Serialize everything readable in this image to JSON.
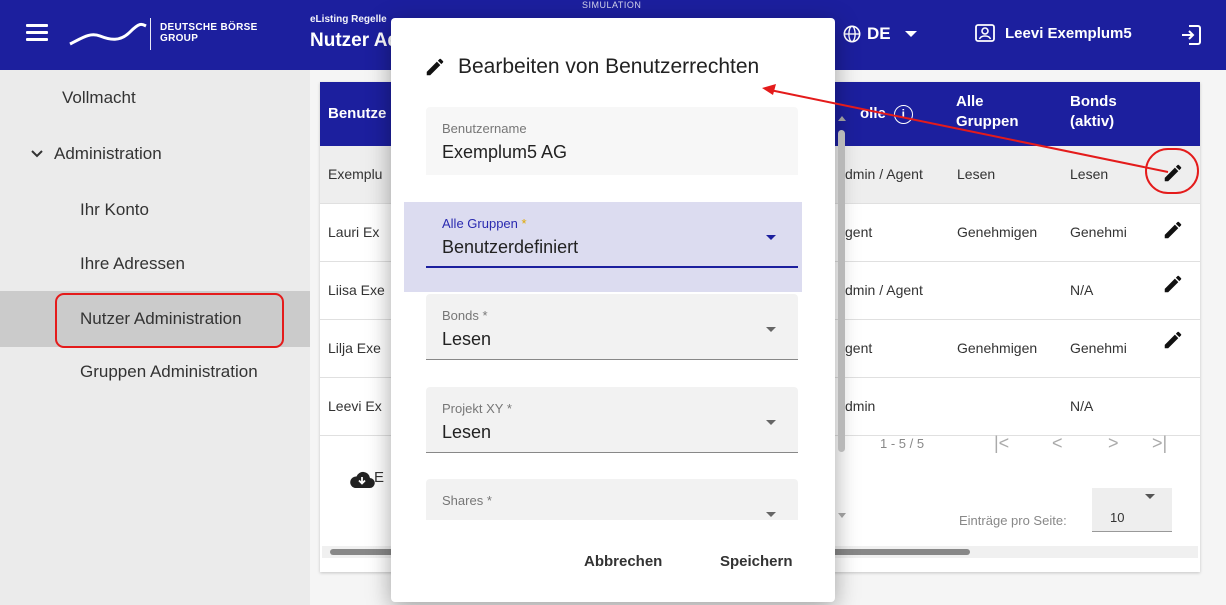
{
  "header": {
    "logo_line1": "DEUTSCHE BÖRSE",
    "logo_line2": "GROUP",
    "portal_small": "eListing Regelle",
    "page_title": "Nutzer Ad",
    "simulation_label": "SIMULATION",
    "language": "DE",
    "user_name": "Leevi Exemplum5"
  },
  "sidebar": {
    "items": [
      {
        "label": "Vollmacht"
      },
      {
        "label": "Administration"
      },
      {
        "label": "Ihr Konto"
      },
      {
        "label": "Ihre Adressen"
      },
      {
        "label": "Nutzer Administration"
      },
      {
        "label": "Gruppen Administration"
      }
    ]
  },
  "table": {
    "headers": {
      "user": "Benutze",
      "role": "olle",
      "all_groups": "Alle Gruppen",
      "bonds": "Bonds (aktiv)"
    },
    "rows": [
      {
        "user": "Exemplu",
        "role": "dmin / Agent",
        "groups": "Lesen",
        "bonds": "Lesen"
      },
      {
        "user": "Lauri Ex",
        "role": "gent",
        "groups": "Genehmigen",
        "bonds": "Genehmi"
      },
      {
        "user": "Liisa Exe",
        "role": "dmin / Agent",
        "groups": "",
        "bonds": "N/A"
      },
      {
        "user": "Lilja Exe",
        "role": "gent",
        "groups": "Genehmigen",
        "bonds": "Genehmi"
      },
      {
        "user": "Leevi Ex",
        "role": "dmin",
        "groups": "",
        "bonds": "N/A"
      }
    ],
    "range": "1 - 5 / 5",
    "per_page_label": "Einträge pro Seite:",
    "per_page_value": "10",
    "export_label": "E"
  },
  "dialog": {
    "title": "Bearbeiten von Benutzerrechten",
    "fields": {
      "username_label": "Benutzername",
      "username_value": "Exemplum5 AG",
      "all_groups_label": "Alle Gruppen",
      "all_groups_value": "Benutzerdefiniert",
      "bonds_label": "Bonds",
      "bonds_value": "Lesen",
      "project_label": "Projekt XY",
      "project_value": "Lesen",
      "shares_label": "Shares"
    },
    "required_mark": "*",
    "cancel": "Abbrechen",
    "save": "Speichern"
  },
  "colors": {
    "primary": "#1c1f9e",
    "annotation": "#e41b1b",
    "sidebar_bg": "#ebebeb",
    "focused_field_bg": "#dcdcf0"
  },
  "icons": [
    "menu-icon",
    "logo-wave-icon",
    "globe-icon",
    "user-badge-icon",
    "logout-icon",
    "chevron-down-icon",
    "info-icon",
    "pencil-icon",
    "cloud-download-icon",
    "caret-down-icon"
  ]
}
